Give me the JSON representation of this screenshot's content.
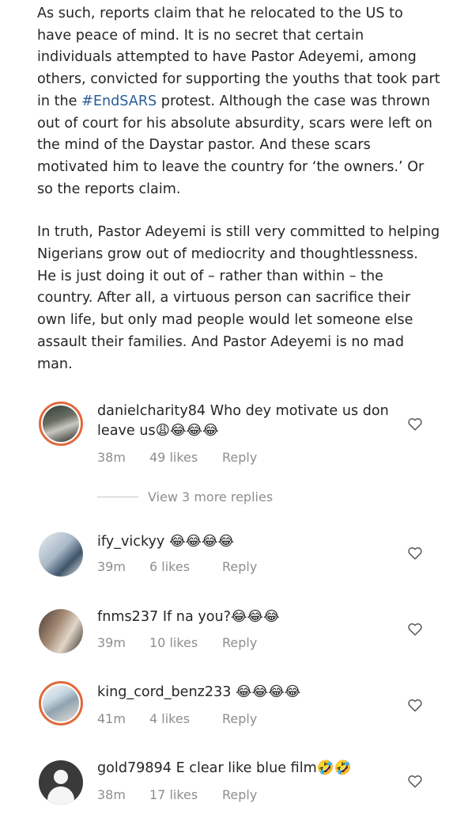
{
  "caption": {
    "p1_a": "As such, reports claim that he relocated to the US to have peace of mind. It is no secret that certain individuals attempted to have Pastor Adeyemi, among others, convicted for supporting the youths that took part in the ",
    "p1_tag": "#EndSARS",
    "p1_b": " protest. Although the case was thrown out of court for his absolute absurdity, scars were left on the mind of the Daystar pastor. And these scars motivated him to leave the country for ‘the owners.’ Or so the reports claim.",
    "p2": "In truth, Pastor Adeyemi is still very committed to helping Nigerians grow out of mediocrity and thoughtlessness. He is just doing it out of – rather than within – the country. After all, a virtuous person can sacrifice their own life, but only mad people would let someone else assault their families. And Pastor Adeyemi is no mad man."
  },
  "comments": [
    {
      "username": "danielcharity84",
      "text": "Who dey motivate us don leave us😩😂😂😂",
      "time": "38m",
      "likes": "49 likes",
      "reply": "Reply"
    },
    {
      "username": "ify_vickyy",
      "text": "😂😂😂😂",
      "time": "39m",
      "likes": "6 likes",
      "reply": "Reply"
    },
    {
      "username": "fnms237",
      "text": "If na you?😂😂😂",
      "time": "39m",
      "likes": "10 likes",
      "reply": "Reply"
    },
    {
      "username": "king_cord_benz233",
      "text": "😂😂😂😂",
      "time": "41m",
      "likes": "4 likes",
      "reply": "Reply"
    },
    {
      "username": "gold79894",
      "text": "E clear like blue film🤣🤣",
      "time": "38m",
      "likes": "17 likes",
      "reply": "Reply"
    }
  ],
  "view_replies": "View 3 more replies",
  "icons": {
    "like": "heart-outline-icon",
    "default_avatar": "person-silhouette-icon"
  },
  "colors": {
    "hashtag": "#2b5d96",
    "story_ring": "#e06a3c",
    "meta_text": "#8e8e8e"
  }
}
